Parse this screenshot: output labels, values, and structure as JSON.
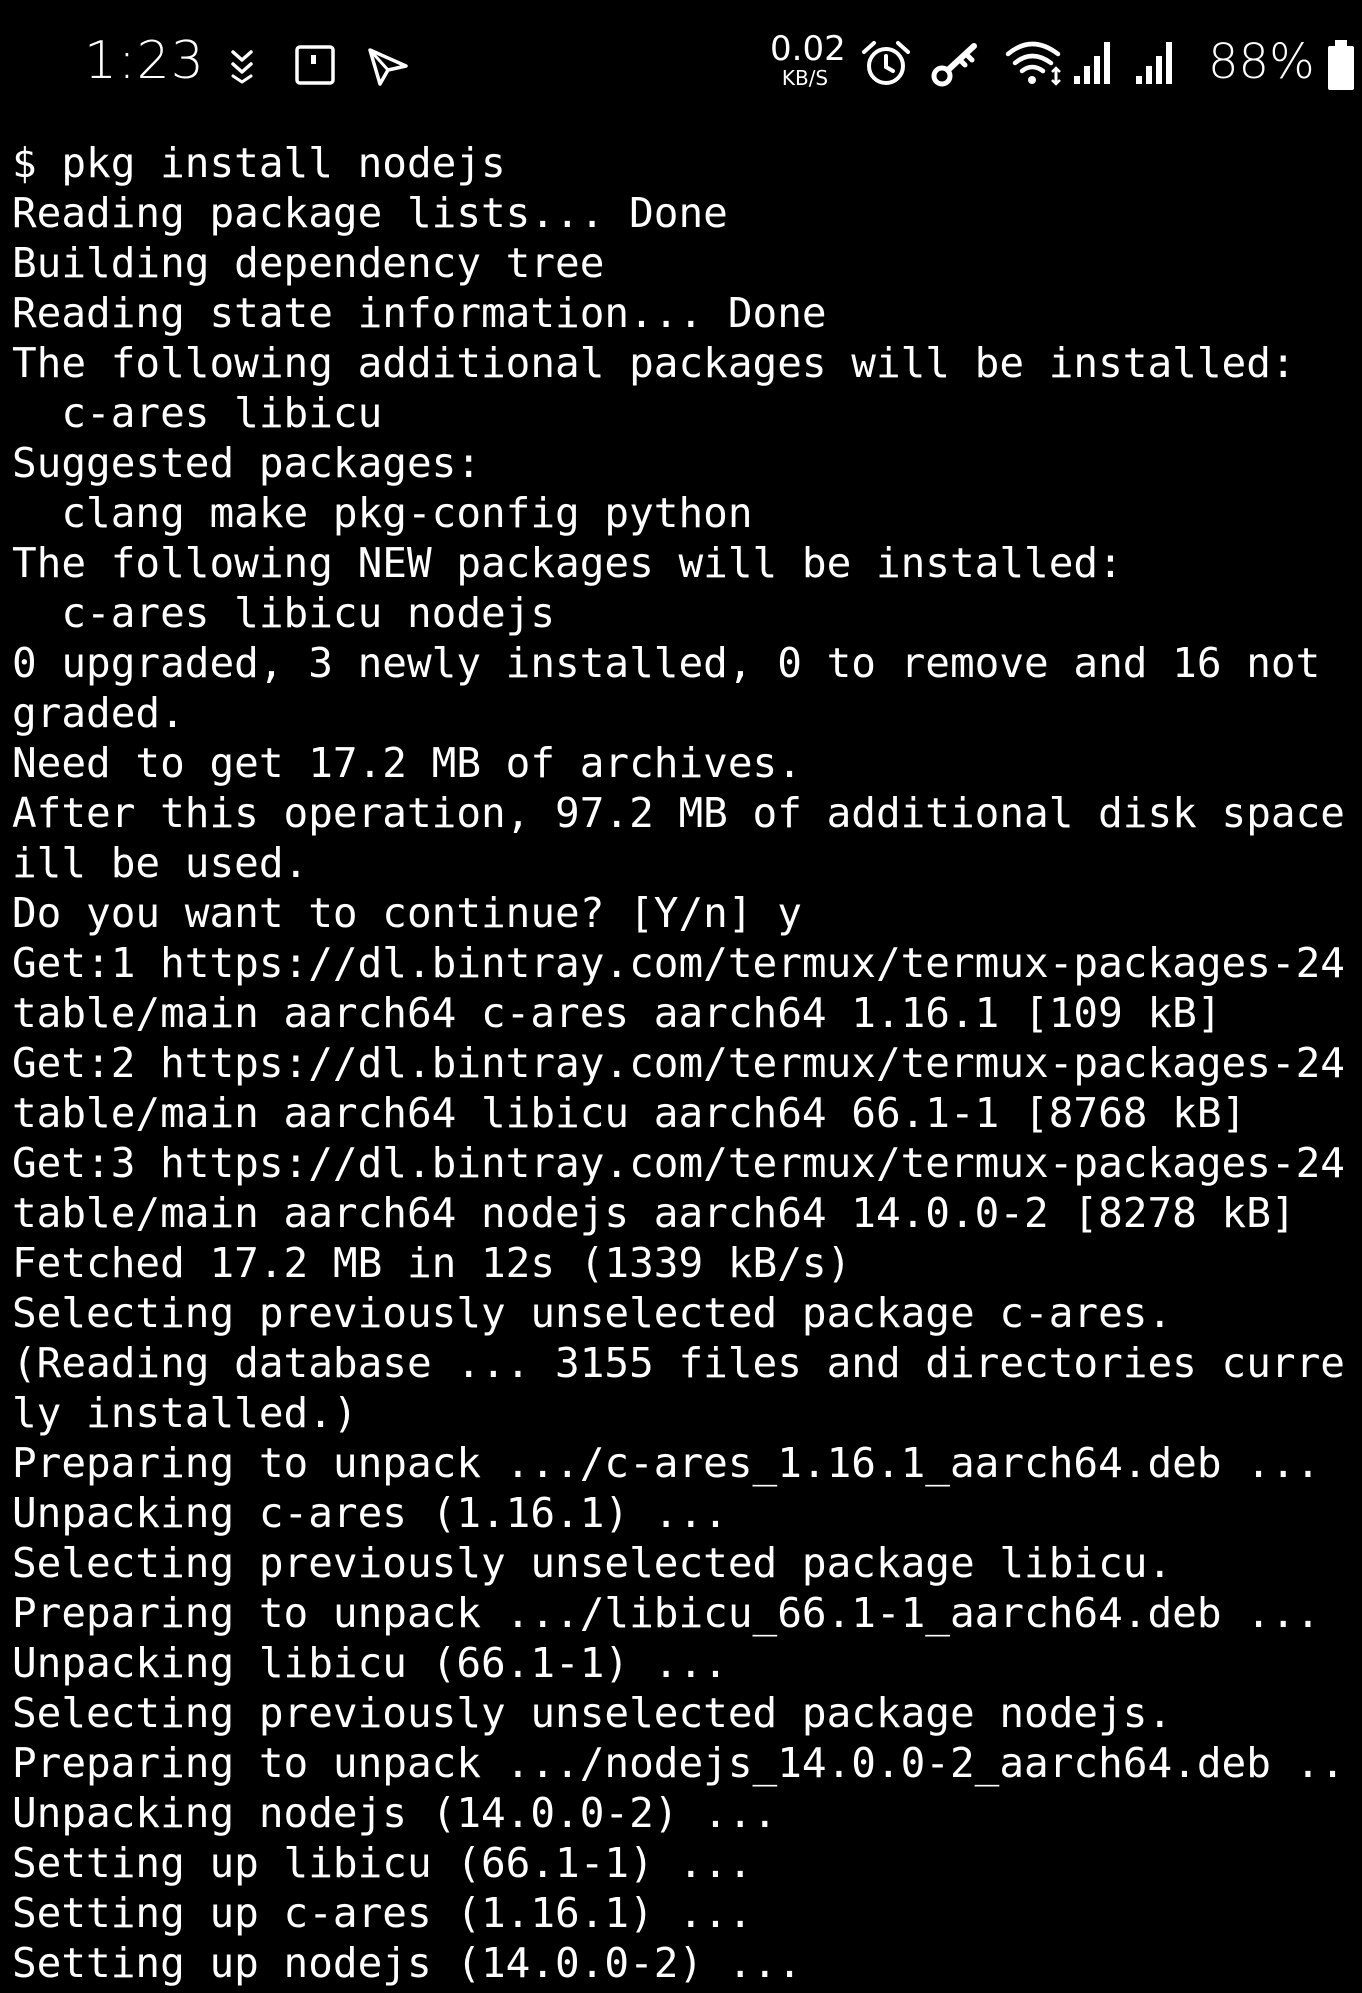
{
  "status_bar": {
    "time": "1:23",
    "net_speed": "0.02",
    "net_unit": "KB/S",
    "battery_percent": "88%",
    "icons": [
      "double-chevron-down-icon",
      "screenshot-icon",
      "location-arrow-icon",
      "alarm-icon",
      "vpn-key-icon",
      "wifi-icon",
      "signal-icon",
      "signal-icon",
      "battery-icon"
    ]
  },
  "terminal": {
    "lines": [
      "$ pkg install nodejs",
      "Reading package lists... Done",
      "Building dependency tree",
      "Reading state information... Done",
      "The following additional packages will be installed:",
      "  c-ares libicu",
      "Suggested packages:",
      "  clang make pkg-config python",
      "The following NEW packages will be installed:",
      "  c-ares libicu nodejs",
      "0 upgraded, 3 newly installed, 0 to remove and 16 not",
      "graded.",
      "Need to get 17.2 MB of archives.",
      "After this operation, 97.2 MB of additional disk space",
      "ill be used.",
      "Do you want to continue? [Y/n] y",
      "Get:1 https://dl.bintray.com/termux/termux-packages-24",
      "table/main aarch64 c-ares aarch64 1.16.1 [109 kB]",
      "Get:2 https://dl.bintray.com/termux/termux-packages-24",
      "table/main aarch64 libicu aarch64 66.1-1 [8768 kB]",
      "Get:3 https://dl.bintray.com/termux/termux-packages-24",
      "table/main aarch64 nodejs aarch64 14.0.0-2 [8278 kB]",
      "Fetched 17.2 MB in 12s (1339 kB/s)",
      "Selecting previously unselected package c-ares.",
      "(Reading database ... 3155 files and directories curre",
      "ly installed.)",
      "Preparing to unpack .../c-ares_1.16.1_aarch64.deb ...",
      "Unpacking c-ares (1.16.1) ...",
      "Selecting previously unselected package libicu.",
      "Preparing to unpack .../libicu_66.1-1_aarch64.deb ...",
      "Unpacking libicu (66.1-1) ...",
      "Selecting previously unselected package nodejs.",
      "Preparing to unpack .../nodejs_14.0.0-2_aarch64.deb ..",
      "Unpacking nodejs (14.0.0-2) ...",
      "Setting up libicu (66.1-1) ...",
      "Setting up c-ares (1.16.1) ...",
      "Setting up nodejs (14.0.0-2) ..."
    ]
  },
  "colors": {
    "background": "#000000",
    "foreground": "#ffffff"
  }
}
